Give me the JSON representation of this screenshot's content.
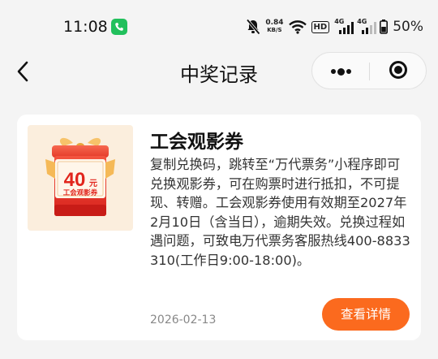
{
  "status_bar": {
    "time": "11:08",
    "speed_value": "0.84",
    "speed_unit": "KB/S",
    "hd": "HD",
    "sim1": "4G",
    "sim2": "4G",
    "battery": "50%",
    "call_badge_color": "#21c05c"
  },
  "nav": {
    "title": "中奖记录"
  },
  "card": {
    "title": "工会观影券",
    "description": "复制兑换码，跳转至“万代票务”小程序即可兑换观影券，可在购票时进行抵扣，不可提现、转赠。工会观影券使用有效期至2027年2月10日（含当日），逾期失效。兑换过程如遇问题，可致电万代票务客服热线400-8833310(工作日9:00-18:00)。",
    "date": "2026-02-13",
    "button_label": "查看详情",
    "button_color": "#fb6a1e",
    "voucher": {
      "amount": "40",
      "unit": "元",
      "label": "工会观影券"
    }
  }
}
